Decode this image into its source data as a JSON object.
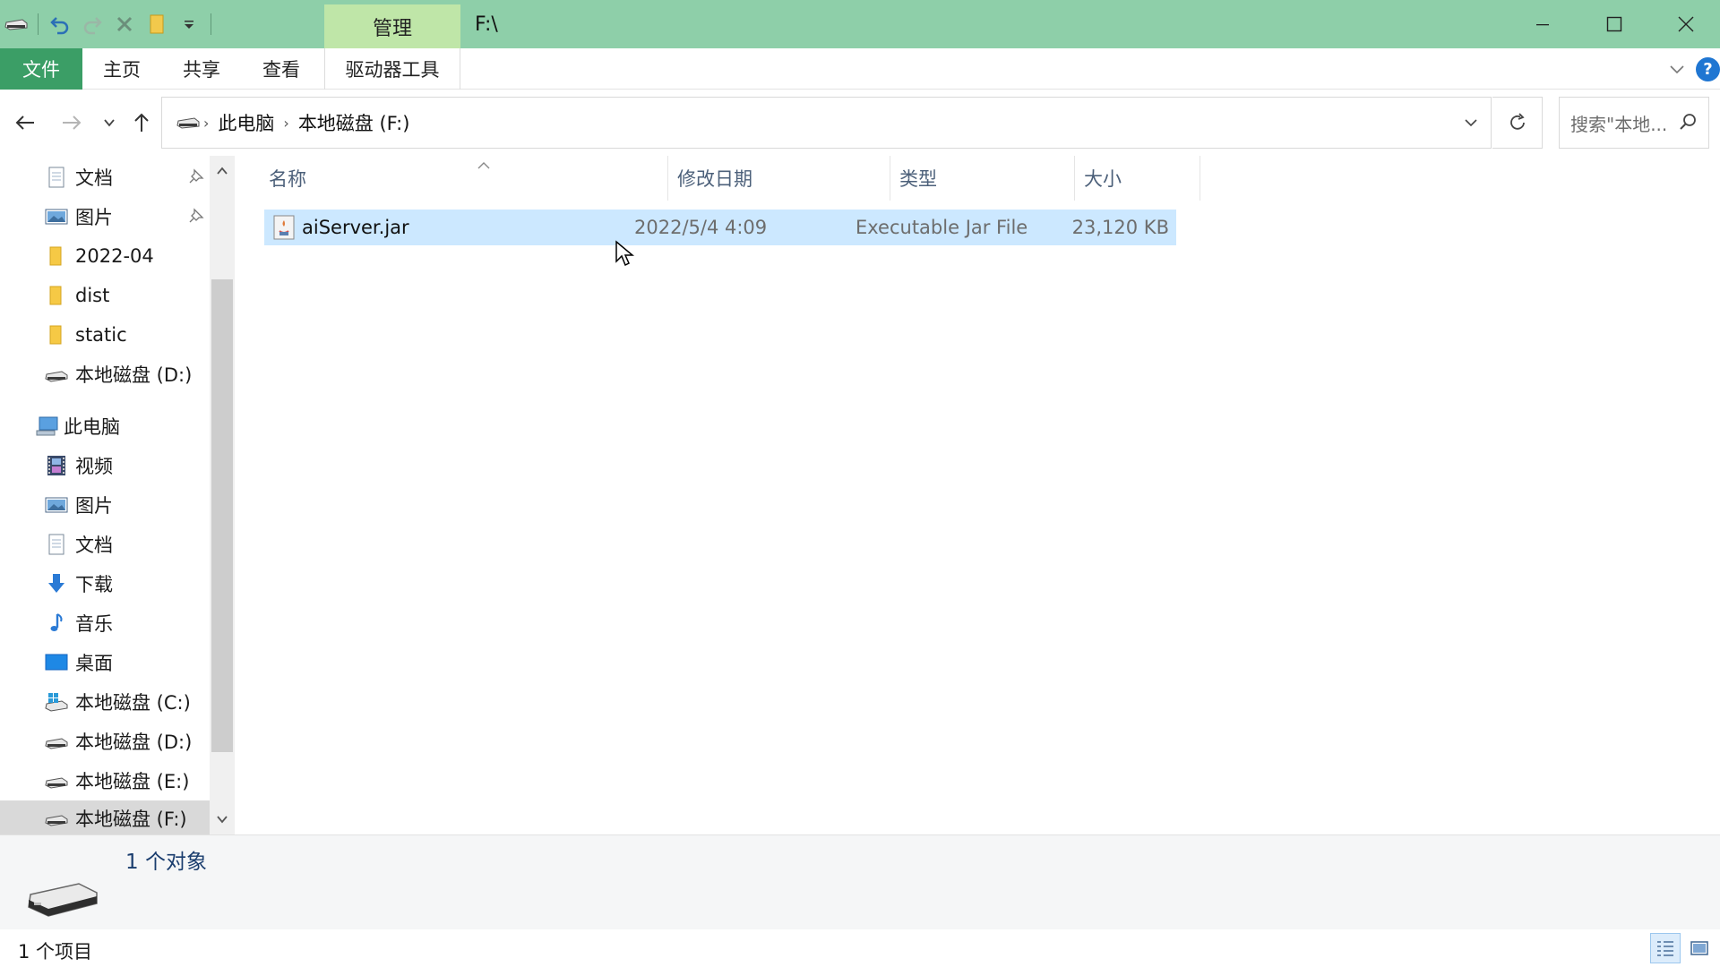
{
  "titlebar": {
    "manage_tab": "管理",
    "path": "F:\\"
  },
  "ribbon": {
    "tabs": [
      "文件",
      "主页",
      "共享",
      "查看",
      "驱动器工具"
    ],
    "help": "?"
  },
  "address": {
    "crumbs": [
      "此电脑",
      "本地磁盘 (F:)"
    ],
    "search_placeholder": "搜索\"本地..."
  },
  "navpane": {
    "items": [
      {
        "label": "文档",
        "icon": "document-icon",
        "pinned": true
      },
      {
        "label": "图片",
        "icon": "pictures-icon",
        "pinned": true
      },
      {
        "label": "2022-04",
        "icon": "folder-icon"
      },
      {
        "label": "dist",
        "icon": "folder-icon"
      },
      {
        "label": "static",
        "icon": "folder-icon"
      },
      {
        "label": "本地磁盘 (D:)",
        "icon": "drive-icon"
      },
      {
        "label": "此电脑",
        "icon": "this-pc-icon"
      },
      {
        "label": "视频",
        "icon": "videos-icon"
      },
      {
        "label": "图片",
        "icon": "pictures-icon"
      },
      {
        "label": "文档",
        "icon": "document-icon"
      },
      {
        "label": "下载",
        "icon": "downloads-icon"
      },
      {
        "label": "音乐",
        "icon": "music-icon"
      },
      {
        "label": "桌面",
        "icon": "desktop-icon"
      },
      {
        "label": "本地磁盘 (C:)",
        "icon": "windows-drive-icon"
      },
      {
        "label": "本地磁盘 (D:)",
        "icon": "drive-icon"
      },
      {
        "label": "本地磁盘 (E:)",
        "icon": "drive-icon"
      },
      {
        "label": "本地磁盘 (F:)",
        "icon": "drive-icon",
        "selected": true
      }
    ]
  },
  "filelist": {
    "columns": [
      "名称",
      "修改日期",
      "类型",
      "大小"
    ],
    "rows": [
      {
        "name": "aiServer.jar",
        "date": "2022/5/4 4:09",
        "type": "Executable Jar File",
        "size": "23,120 KB",
        "icon": "jar-file-icon"
      }
    ]
  },
  "details": {
    "title": "1 个对象"
  },
  "status": {
    "text": "1 个项目"
  },
  "colors": {
    "titlebar": "#8ecfa9",
    "manage_tab": "#bfe6a8",
    "file_tab": "#3b9e66",
    "selection": "#cce8ff"
  }
}
